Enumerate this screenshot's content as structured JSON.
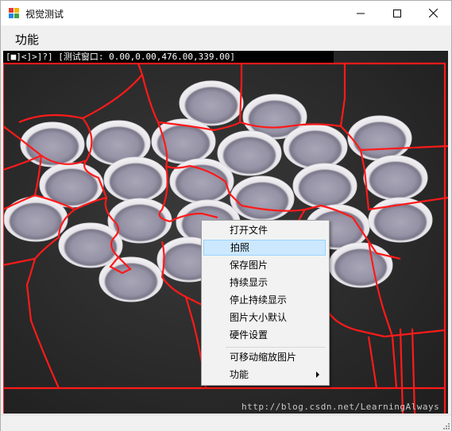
{
  "window": {
    "title": "视觉测试"
  },
  "menu": {
    "items": [
      "功能"
    ]
  },
  "viewer": {
    "info_text": "[■]<]>]?] [测试窗口: 0.00,0.00,476.00,339.00]",
    "watermark": "http://blog.csdn.net/LearningAlways",
    "overlay_color": "#ff1a1a"
  },
  "context_menu": {
    "items": [
      {
        "label": "打开文件"
      },
      {
        "label": "拍照",
        "highlighted": true
      },
      {
        "label": "保存图片"
      },
      {
        "label": "持续显示"
      },
      {
        "label": "停止持续显示"
      },
      {
        "label": "图片大小默认"
      },
      {
        "label": "硬件设置"
      },
      {
        "label": "可移动缩放图片"
      },
      {
        "label": "功能",
        "submenu": true
      }
    ]
  },
  "colors": {
    "highlight_bg": "#cce8ff",
    "highlight_border": "#99d1ff"
  }
}
